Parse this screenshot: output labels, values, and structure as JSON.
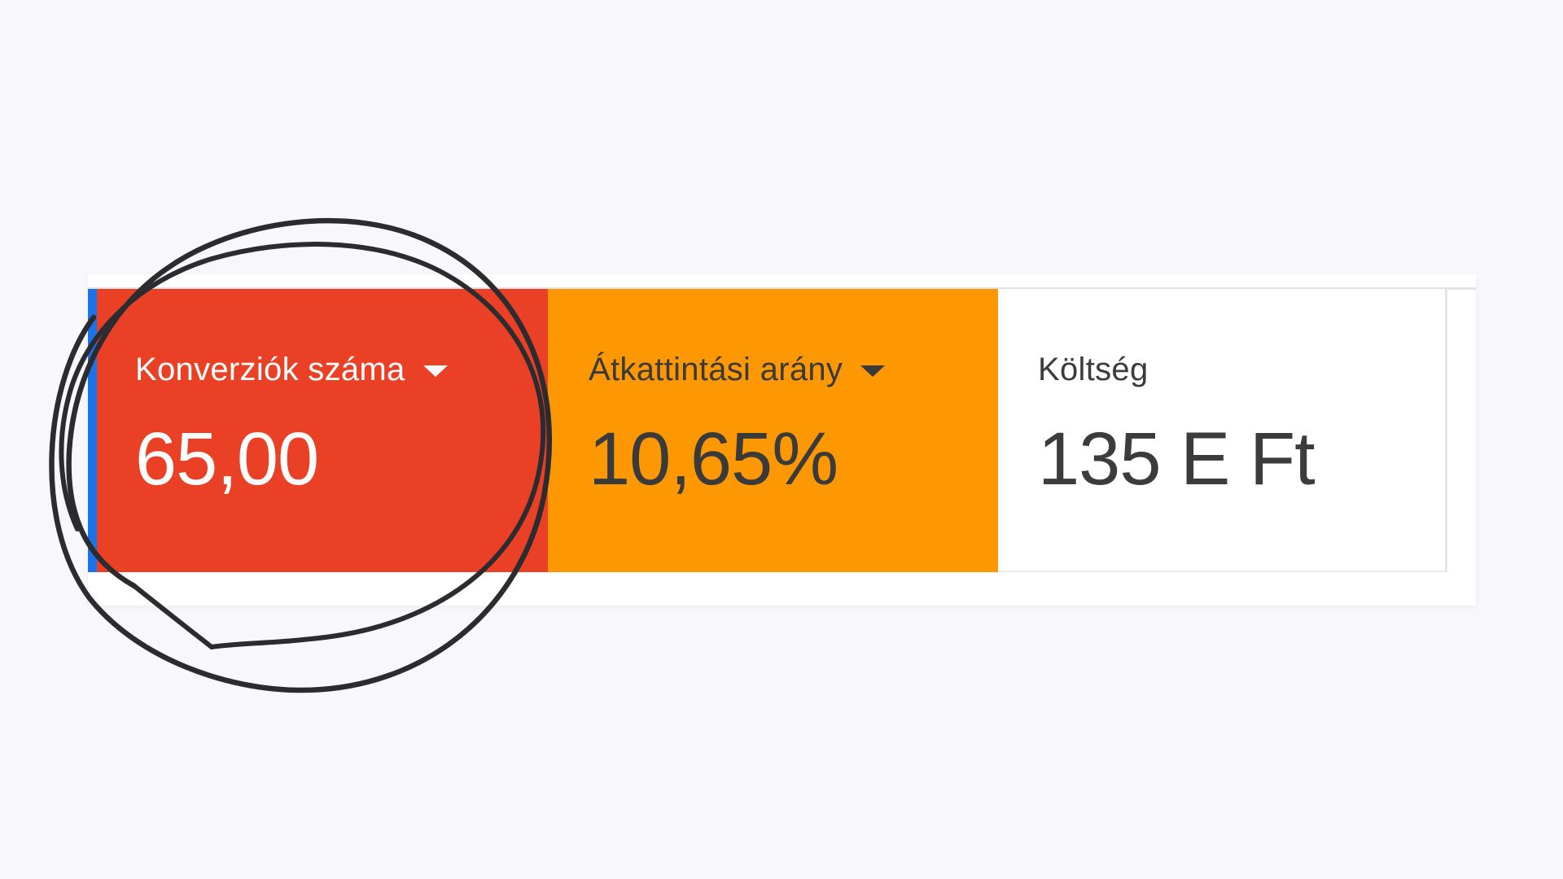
{
  "scorecards": [
    {
      "label": "Konverziók száma",
      "value": "65,00",
      "has_dropdown": true,
      "color": "#e94026",
      "accent": "#1a73e8"
    },
    {
      "label": "Átkattintási arány",
      "value": "10,65%",
      "has_dropdown": true,
      "color": "#fd9802"
    },
    {
      "label": "Költség",
      "value": "135 E Ft",
      "has_dropdown": false,
      "color": "#ffffff"
    }
  ],
  "annotation": {
    "type": "hand-drawn circle",
    "target": "Konverziók száma",
    "color": "#2c2c30"
  },
  "icons": {
    "dropdown": "caret-down-icon"
  }
}
